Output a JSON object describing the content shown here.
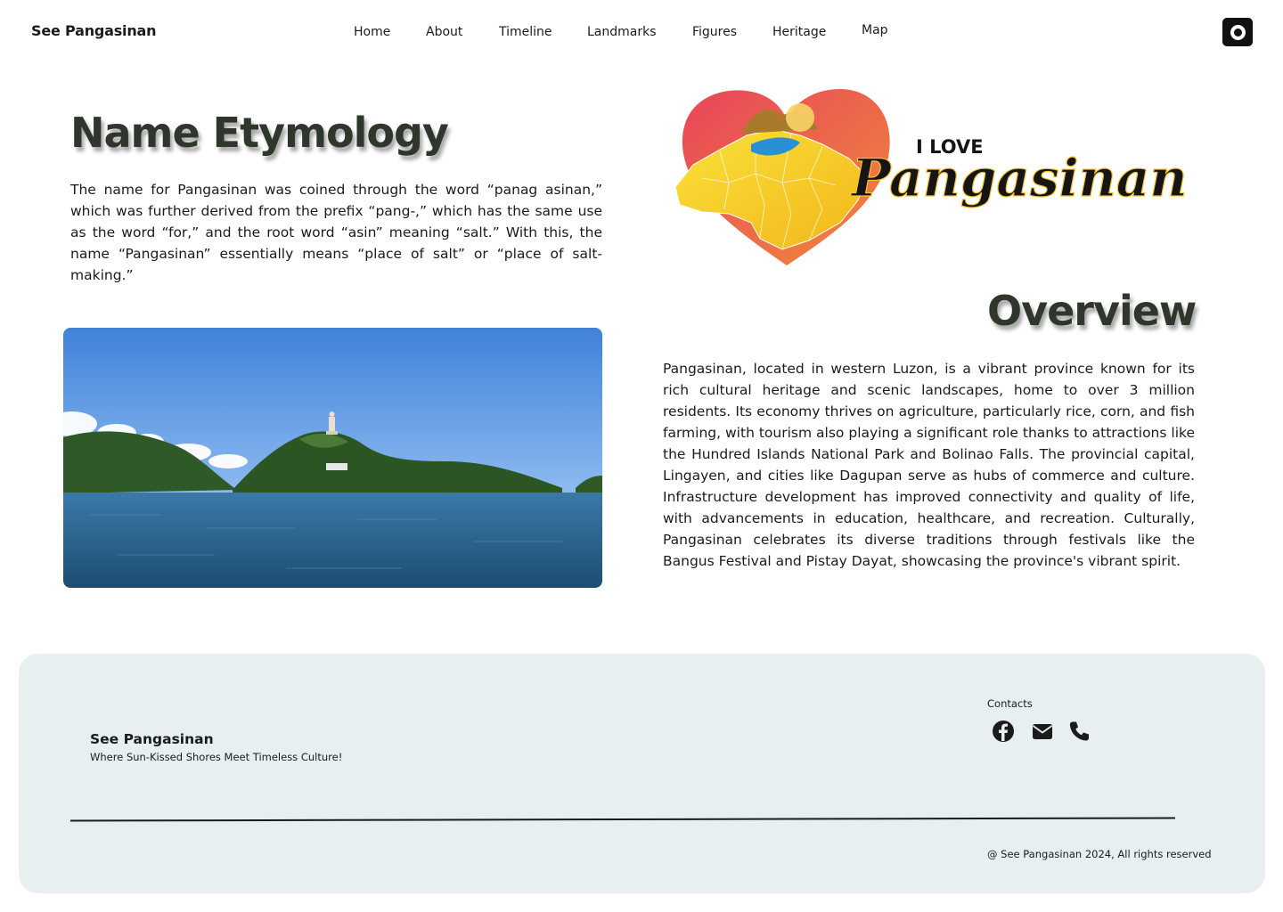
{
  "header": {
    "brand": "See Pangasinan",
    "nav": [
      "Home",
      "About",
      "Timeline",
      "Landmarks",
      "Figures",
      "Heritage",
      "Map"
    ]
  },
  "etymology": {
    "title": "Name Etymology",
    "body": "The name for Pangasinan was coined through the word “panag asinan,” which was further derived from the prefix “pang-,” which has the same use as the word “for,” and the root word “asin” meaning “salt.” With this, the name “Pangasinan” essentially means “place of salt” or “place of salt-making.”"
  },
  "logo": {
    "line1": "I LOVE",
    "line2": "Pangasinan"
  },
  "overview": {
    "title": "Overview",
    "body": "Pangasinan, located in western Luzon, is a vibrant province known for its rich cultural heritage and scenic landscapes, home to over 3 million residents. Its economy thrives on agriculture, particularly rice, corn, and fish farming, with tourism also playing a significant role thanks to attractions like the Hundred Islands National Park and Bolinao Falls. The provincial capital, Lingayen, and cities like Dagupan serve as hubs of commerce and culture. Infrastructure development has improved connectivity and quality of life, with advancements in education, healthcare, and recreation. Culturally, Pangasinan celebrates its diverse traditions through festivals like the Bangus Festival and Pistay Dayat, showcasing the province's vibrant spirit."
  },
  "footer": {
    "brand": "See Pangasinan",
    "tagline": "Where Sun-Kissed Shores Meet Timeless Culture!",
    "contacts_label": "Contacts",
    "contact_icons": [
      "facebook-icon",
      "mail-icon",
      "phone-icon"
    ],
    "copyright": "@ See Pangasinan 2024, All rights reserved"
  },
  "colors": {
    "heading": "#2f362c",
    "footer_bg": "#e8eff1",
    "heart": "#e8455a",
    "map_yellow": "#f7d21c"
  }
}
